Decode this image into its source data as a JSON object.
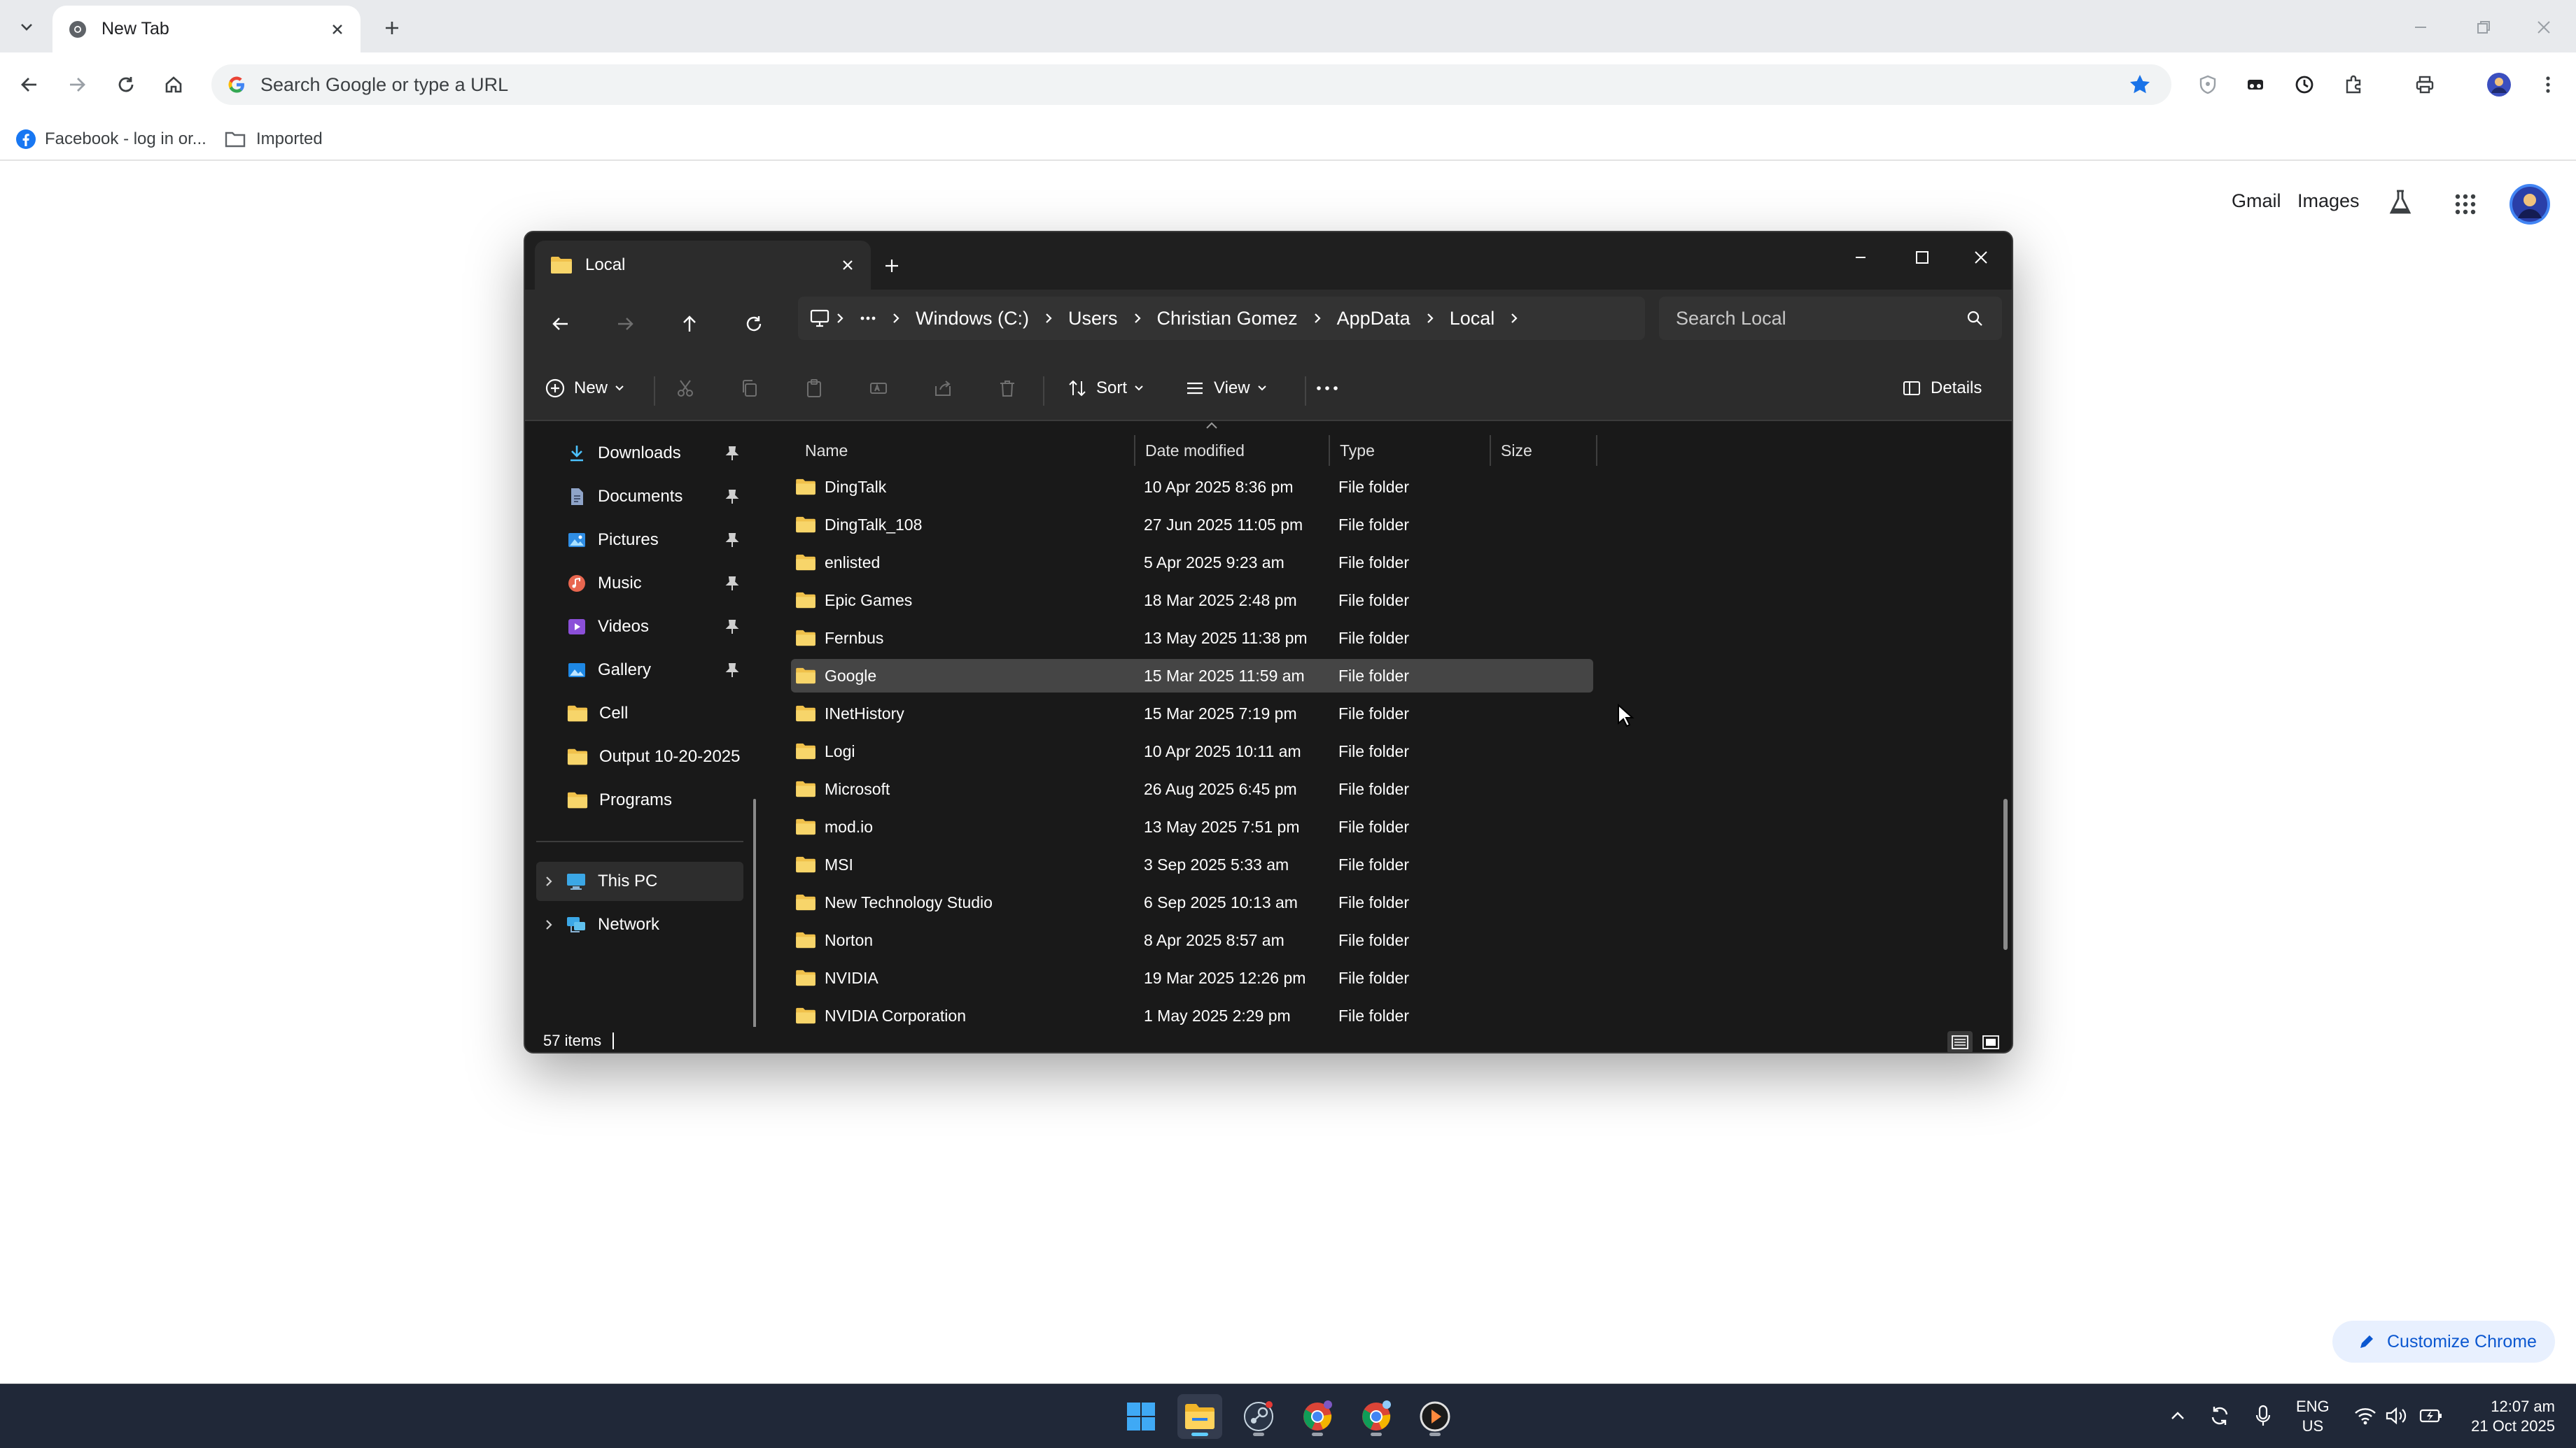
{
  "browser": {
    "tab_title": "New Tab",
    "omnibox_placeholder": "Search Google or type a URL",
    "bookmarks": [
      {
        "label": "Facebook - log in or..."
      },
      {
        "label": "Imported"
      }
    ],
    "google_links": {
      "gmail": "Gmail",
      "images": "Images"
    },
    "customize_label": "Customize Chrome"
  },
  "explorer": {
    "tab_title": "Local",
    "breadcrumbs": [
      "Windows (C:)",
      "Users",
      "Christian Gomez",
      "AppData",
      "Local"
    ],
    "search_placeholder": "Search Local",
    "commands": {
      "new": "New",
      "sort": "Sort",
      "view": "View",
      "details": "Details"
    },
    "sidebar": [
      {
        "label": "Downloads",
        "icon": "download-icon",
        "pinned": true
      },
      {
        "label": "Documents",
        "icon": "document-icon",
        "pinned": true
      },
      {
        "label": "Pictures",
        "icon": "picture-icon",
        "pinned": true
      },
      {
        "label": "Music",
        "icon": "music-icon",
        "pinned": true
      },
      {
        "label": "Videos",
        "icon": "video-icon",
        "pinned": true
      },
      {
        "label": "Gallery",
        "icon": "gallery-icon",
        "pinned": true
      },
      {
        "label": "Cell",
        "icon": "folder-icon",
        "pinned": false
      },
      {
        "label": "Output 10-20-2025",
        "icon": "folder-icon",
        "pinned": false
      },
      {
        "label": "Programs",
        "icon": "folder-icon",
        "pinned": false
      },
      {
        "label": "This PC",
        "icon": "this-pc-icon",
        "pinned": false
      },
      {
        "label": "Network",
        "icon": "network-icon",
        "pinned": false
      }
    ],
    "columns": {
      "name": "Name",
      "date": "Date modified",
      "type": "Type",
      "size": "Size"
    },
    "rows": [
      {
        "name": "DingTalk",
        "date": "10 Apr 2025 8:36 pm",
        "type": "File folder"
      },
      {
        "name": "DingTalk_108",
        "date": "27 Jun 2025 11:05 pm",
        "type": "File folder"
      },
      {
        "name": "enlisted",
        "date": "5 Apr 2025 9:23 am",
        "type": "File folder"
      },
      {
        "name": "Epic Games",
        "date": "18 Mar 2025 2:48 pm",
        "type": "File folder"
      },
      {
        "name": "Fernbus",
        "date": "13 May 2025 11:38 pm",
        "type": "File folder"
      },
      {
        "name": "Google",
        "date": "15 Mar 2025 11:59 am",
        "type": "File folder",
        "selected": true
      },
      {
        "name": "INetHistory",
        "date": "15 Mar 2025 7:19 pm",
        "type": "File folder"
      },
      {
        "name": "Logi",
        "date": "10 Apr 2025 10:11 am",
        "type": "File folder"
      },
      {
        "name": "Microsoft",
        "date": "26 Aug 2025 6:45 pm",
        "type": "File folder"
      },
      {
        "name": "mod.io",
        "date": "13 May 2025 7:51 pm",
        "type": "File folder"
      },
      {
        "name": "MSI",
        "date": "3 Sep 2025 5:33 am",
        "type": "File folder"
      },
      {
        "name": "New Technology Studio",
        "date": "6 Sep 2025 10:13 am",
        "type": "File folder"
      },
      {
        "name": "Norton",
        "date": "8 Apr 2025 8:57 am",
        "type": "File folder"
      },
      {
        "name": "NVIDIA",
        "date": "19 Mar 2025 12:26 pm",
        "type": "File folder"
      },
      {
        "name": "NVIDIA Corporation",
        "date": "1 May 2025 2:29 pm",
        "type": "File folder"
      }
    ],
    "status": "57 items"
  },
  "taskbar": {
    "lang_top": "ENG",
    "lang_bottom": "US",
    "time": "12:07 am",
    "date": "21 Oct 2025"
  },
  "colors": {
    "folder": "#f0c14b",
    "accent": "#0b57d0",
    "explorer_bg": "#191919"
  }
}
